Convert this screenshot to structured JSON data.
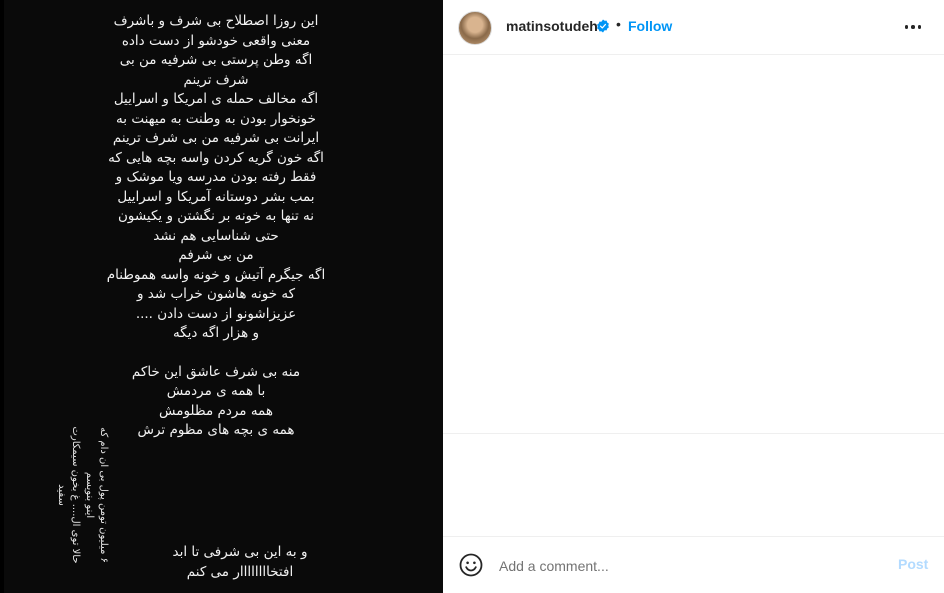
{
  "story": {
    "lines": [
      "این روزا اصطلاح بی شرف و باشرف",
      "معنی واقعی خودشو از دست داده",
      "اگه وطن پرستی بی شرفیه من بی",
      "شرف ترینم",
      "اگه مخالف حمله ی امریکا و اسراییل",
      "خونخوار بودن به وطنت به میهنت به",
      "ایرانت بی شرفیه من بی شرف ترینم",
      "اگه خون گریه کردن واسه بچه هایی که",
      "فقط رفته بودن مدرسه ویا موشک و",
      "بمب بشر دوستانه آمریکا و اسراییل",
      "نه تنها به خونه بر نگشتن و یکیشون",
      "حتی شناسایی هم نشد",
      "من بی شرفم",
      "اگه جیگرم آتیش و خونه واسه هموطنام",
      "که خونه هاشون خراب شد و",
      "عزیزاشونو از دست دادن ....",
      "و هزار اگه دیگه",
      "",
      "منه بی شرف عاشق این خاکم",
      "با همه ی مردمش",
      "همه مردم مظلومش",
      "همه ی بچه های مظوم ترش"
    ],
    "ending": [
      "و به این بی شرفی تا ابد",
      "افتخاااااااار می کنم"
    ],
    "side_note": [
      "۶ میلیون تومن پول بی ان دام که",
      "اینو بنویسم",
      "حالا توی ال.... غ بخون سیمکارت",
      "سفید"
    ]
  },
  "header": {
    "username": "matinsotudeh",
    "separator": "•",
    "follow_label": "Follow"
  },
  "comment": {
    "placeholder": "Add a comment...",
    "post_label": "Post"
  },
  "colors": {
    "accent": "#0095f6",
    "verified": "#0095f6",
    "post_disabled": "#b3dbff"
  },
  "icons": {
    "verified": "verified-badge-icon",
    "more": "more-options-icon",
    "emoji": "emoji-icon"
  }
}
